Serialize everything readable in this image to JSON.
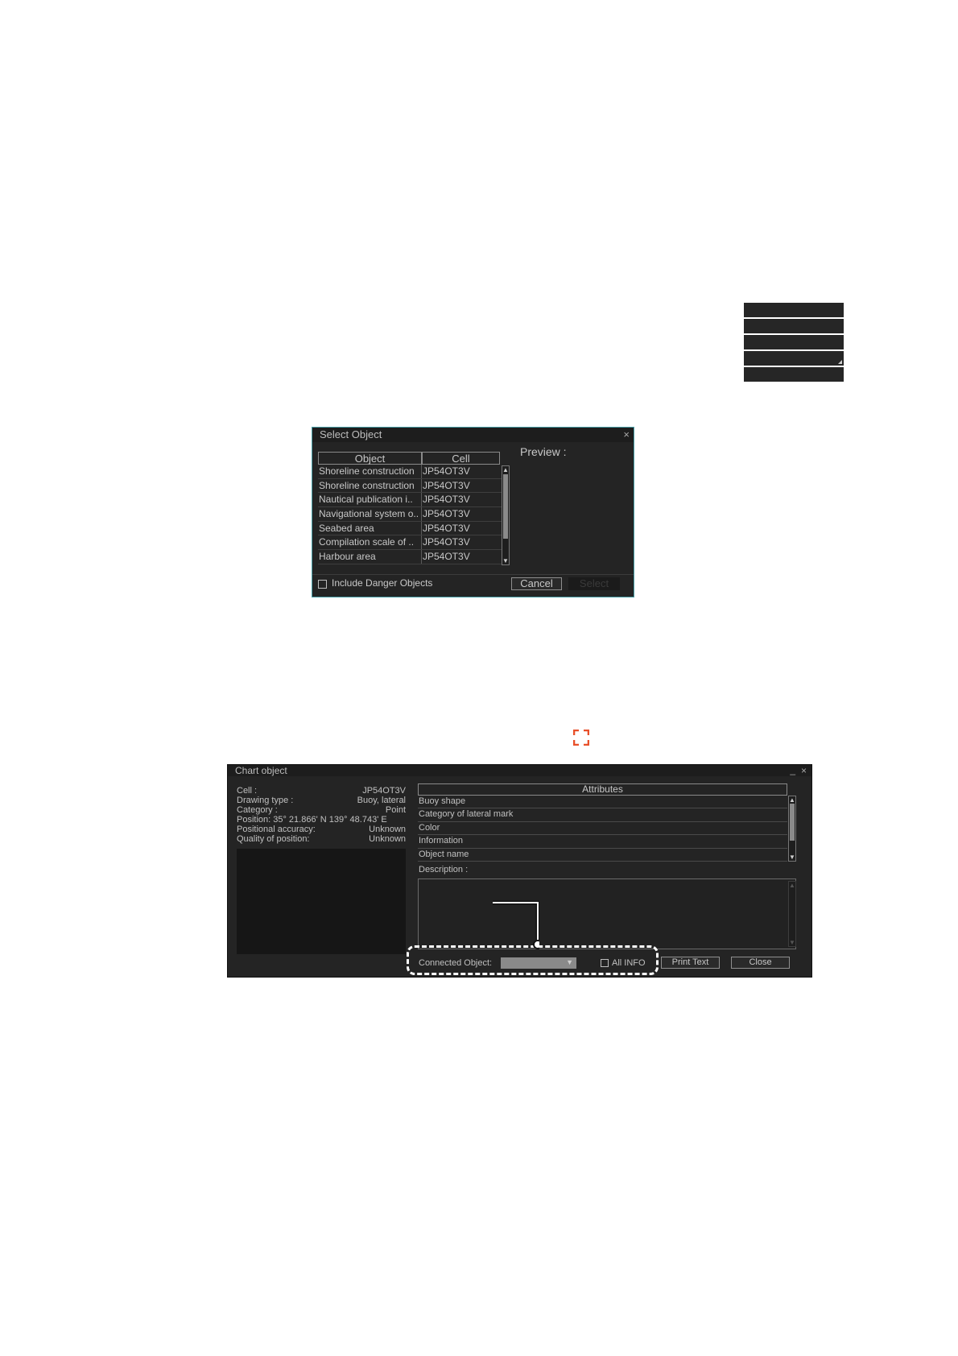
{
  "context_menu": {
    "item_count": 5
  },
  "select_object": {
    "title": "Select Object",
    "columns": {
      "object": "Object",
      "cell": "Cell"
    },
    "rows": [
      {
        "object": "Shoreline construction",
        "cell": "JP54OT3V"
      },
      {
        "object": "Shoreline construction",
        "cell": "JP54OT3V"
      },
      {
        "object": "Nautical publication i..",
        "cell": "JP54OT3V"
      },
      {
        "object": "Navigational system o..",
        "cell": "JP54OT3V"
      },
      {
        "object": "Seabed area",
        "cell": "JP54OT3V"
      },
      {
        "object": "Compilation scale of ..",
        "cell": "JP54OT3V"
      },
      {
        "object": "Harbour area",
        "cell": "JP54OT3V"
      }
    ],
    "preview_label": "Preview :",
    "include_danger_label": "Include Danger Objects",
    "cancel_label": "Cancel",
    "select_label": "Select"
  },
  "chart_object": {
    "title": "Chart object",
    "info": [
      {
        "label": "Cell :",
        "value": "JP54OT3V"
      },
      {
        "label": "Drawing type :",
        "value": "Buoy, lateral"
      },
      {
        "label": "Category :",
        "value": "Point"
      },
      {
        "label": "Position:  35° 21.866' N   139° 48.743' E",
        "value": ""
      },
      {
        "label": "Positional accuracy:",
        "value": "Unknown"
      },
      {
        "label": "Quality of position:",
        "value": "Unknown"
      }
    ],
    "attributes_header": "Attributes",
    "attributes": [
      "Buoy shape",
      "Category of lateral mark",
      "Color",
      "Information",
      "Object name"
    ],
    "description_label": "Description :",
    "connected_object_label": "Connected Object:",
    "all_info_label": "All INFO",
    "print_text_label": "Print Text",
    "close_label": "Close"
  },
  "colors": {
    "dialog_bg": "#242424",
    "accent_border": "#4aa0a8",
    "bracket_icon": "#e8502a",
    "callout": "#ffffff"
  }
}
